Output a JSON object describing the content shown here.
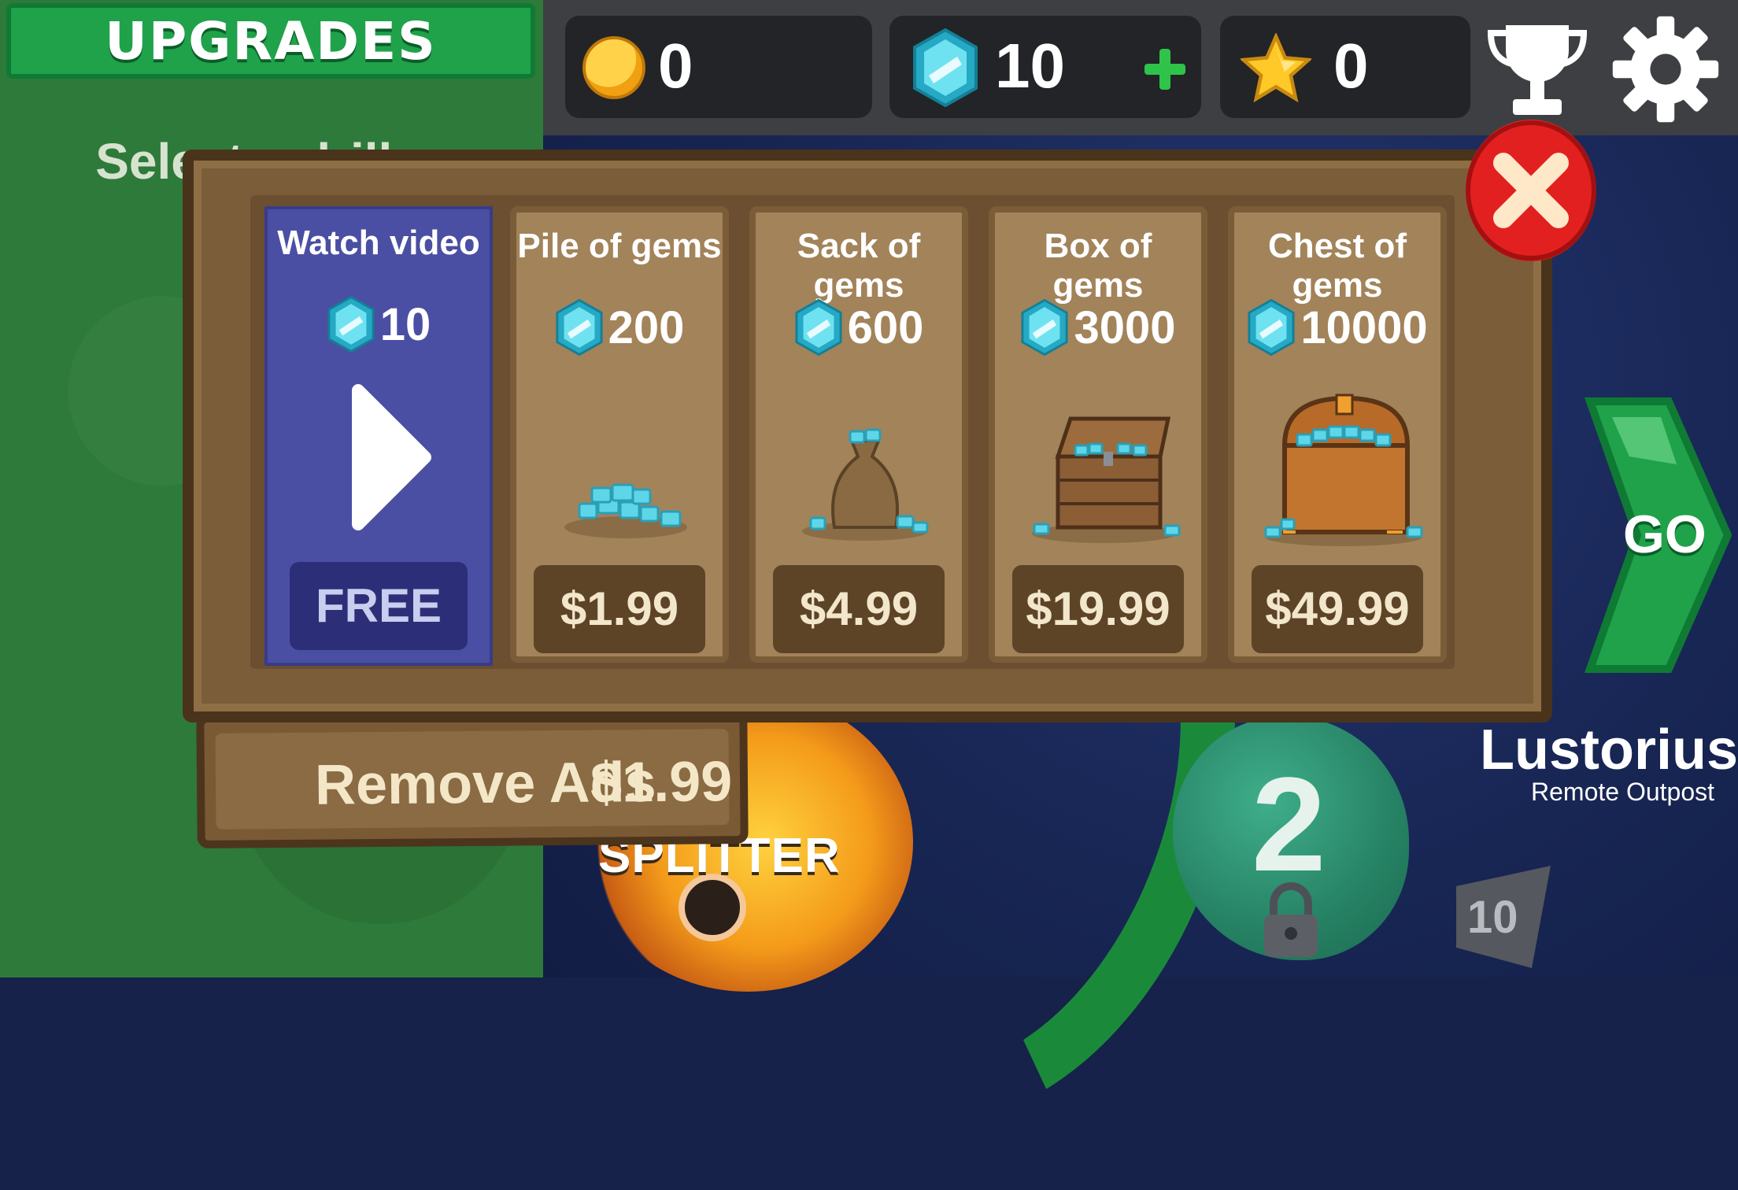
{
  "header": {
    "upgrades_title": "UPGRADES"
  },
  "currency": {
    "coins": "0",
    "gems": "10",
    "stars": "0"
  },
  "background": {
    "select_text": "Select a driller part",
    "remove_ads_label": "Remove Ads",
    "remove_ads_price": "$1.99",
    "creature_label": "SPLITTER",
    "planet_number": "2",
    "level_number": "10",
    "planet_name": "Lustorius",
    "planet_subtitle": "Remote Outpost",
    "go_label": "GO"
  },
  "shop": {
    "cards": [
      {
        "title": "Watch video",
        "gems": "10",
        "price": "FREE"
      },
      {
        "title": "Pile of gems",
        "gems": "200",
        "price": "$1.99"
      },
      {
        "title": "Sack of gems",
        "gems": "600",
        "price": "$4.99"
      },
      {
        "title": "Box of gems",
        "gems": "3000",
        "price": "$19.99"
      },
      {
        "title": "Chest of gems",
        "gems": "10000",
        "price": "$49.99"
      }
    ]
  },
  "icons": {
    "coin": "coin-icon",
    "gem": "gem-icon",
    "plus": "plus-icon",
    "star": "star-icon",
    "trophy": "trophy-icon",
    "settings": "gear-icon",
    "close": "close-icon",
    "play": "play-icon",
    "lock": "lock-icon"
  },
  "colors": {
    "upgrades_green": "#1fa24a",
    "gem_cyan": "#4fd4e6",
    "close_red": "#e32020",
    "video_card": "#4a4fa3",
    "wood": "#a2835a"
  }
}
